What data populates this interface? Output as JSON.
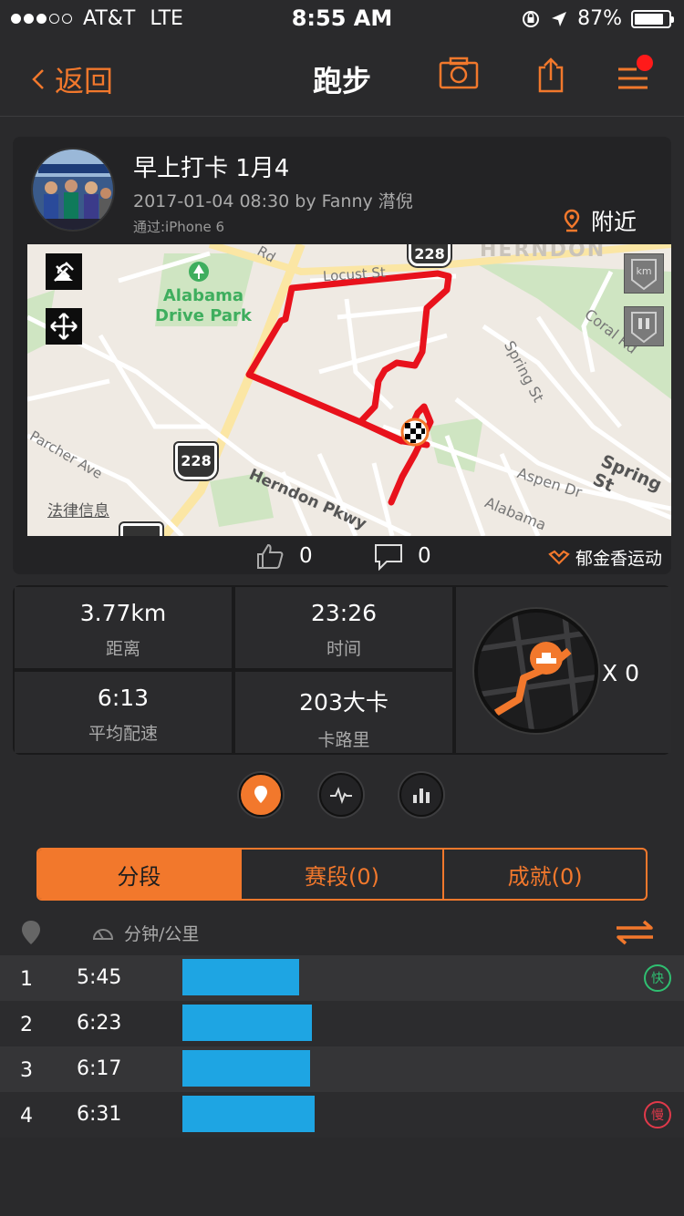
{
  "status_bar": {
    "carrier": "AT&T",
    "network": "LTE",
    "signal_bars": 3,
    "signal_total": 5,
    "time": "8:55 AM",
    "battery_percent": "87%",
    "battery_level": 0.87
  },
  "nav": {
    "back_label": "返回",
    "title": "跑步",
    "icons": [
      "camera-icon",
      "share-icon",
      "menu-icon"
    ]
  },
  "post": {
    "title": "早上打卡 1月4",
    "meta": "2017-01-04 08:30 by Fanny 潸倪",
    "device": "通过:iPhone 6",
    "nearby_label": "附近"
  },
  "map": {
    "legal_label": "法律信息",
    "labels": [
      "Alabama",
      "Drive Park",
      "HERNDON",
      "Locust St",
      "Coral Rd",
      "Spring St",
      "Spring St",
      "Aspen Dr",
      "Alabama",
      "Herndon Pkwy",
      "Parcher Ave",
      "Rd"
    ],
    "shields": [
      "228",
      "228"
    ],
    "side_buttons": [
      "km",
      "pause"
    ]
  },
  "social": {
    "likes": "0",
    "comments": "0",
    "brand": "郁金香运动"
  },
  "stats": [
    {
      "value": "3.77km",
      "label": "距离"
    },
    {
      "value": "23:26",
      "label": "时间"
    },
    {
      "value": "6:13",
      "label": "平均配速"
    },
    {
      "value": "203大卡",
      "label": "卡路里"
    }
  ],
  "route_count": "X 0",
  "tabs": [
    {
      "label": "分段",
      "active": true
    },
    {
      "label": "赛段(0)",
      "active": false
    },
    {
      "label": "成就(0)",
      "active": false
    }
  ],
  "split_header": {
    "unit_label": "分钟/公里"
  },
  "splits": [
    {
      "index": "1",
      "pace": "5:45",
      "bar_ratio": 0.346,
      "tag": "快"
    },
    {
      "index": "2",
      "pace": "6:23",
      "bar_ratio": 0.384,
      "tag": ""
    },
    {
      "index": "3",
      "pace": "6:17",
      "bar_ratio": 0.378,
      "tag": ""
    },
    {
      "index": "4",
      "pace": "6:31",
      "bar_ratio": 0.392,
      "tag": "慢"
    }
  ],
  "colors": {
    "accent": "#f2782c",
    "bar": "#1ea5e3",
    "fast": "#2fbf71",
    "slow": "#e0394a",
    "route": "#e8121c"
  }
}
